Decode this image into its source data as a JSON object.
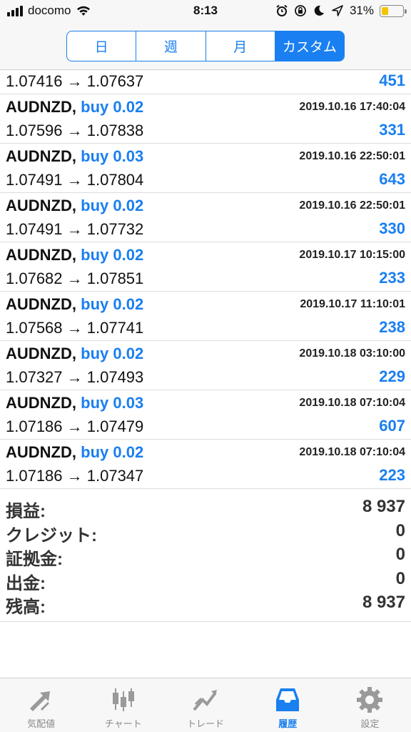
{
  "status_bar": {
    "carrier": "docomo",
    "time": "8:13",
    "battery_percent": "31%",
    "battery_level": 0.31,
    "icons": [
      "signal-icon",
      "wifi-icon",
      "alarm-icon",
      "orientation-lock-icon",
      "moon-icon",
      "location-icon",
      "battery-icon"
    ]
  },
  "period_tabs": [
    {
      "label": "日",
      "active": false
    },
    {
      "label": "週",
      "active": false
    },
    {
      "label": "月",
      "active": false
    },
    {
      "label": "カスタム",
      "active": true
    }
  ],
  "history": {
    "partial_row": {
      "prices": "1.07416 → 1.07637",
      "profit": "451"
    },
    "rows": [
      {
        "symbol": "AUDNZD",
        "separator": ",",
        "trade": "buy 0.02",
        "timestamp": "2019.10.16 17:40:04",
        "prices": "1.07596 → 1.07838",
        "profit": "331"
      },
      {
        "symbol": "AUDNZD",
        "separator": ",",
        "trade": "buy 0.03",
        "timestamp": "2019.10.16 22:50:01",
        "prices": "1.07491 → 1.07804",
        "profit": "643"
      },
      {
        "symbol": "AUDNZD",
        "separator": ",",
        "trade": "buy 0.02",
        "timestamp": "2019.10.16 22:50:01",
        "prices": "1.07491 → 1.07732",
        "profit": "330"
      },
      {
        "symbol": "AUDNZD",
        "separator": ",",
        "trade": "buy 0.02",
        "timestamp": "2019.10.17 10:15:00",
        "prices": "1.07682 → 1.07851",
        "profit": "233"
      },
      {
        "symbol": "AUDNZD",
        "separator": ",",
        "trade": "buy 0.02",
        "timestamp": "2019.10.17 11:10:01",
        "prices": "1.07568 → 1.07741",
        "profit": "238"
      },
      {
        "symbol": "AUDNZD",
        "separator": ",",
        "trade": "buy 0.02",
        "timestamp": "2019.10.18 03:10:00",
        "prices": "1.07327 → 1.07493",
        "profit": "229"
      },
      {
        "symbol": "AUDNZD",
        "separator": ",",
        "trade": "buy 0.03",
        "timestamp": "2019.10.18 07:10:04",
        "prices": "1.07186 → 1.07479",
        "profit": "607"
      },
      {
        "symbol": "AUDNZD",
        "separator": ",",
        "trade": "buy 0.02",
        "timestamp": "2019.10.18 07:10:04",
        "prices": "1.07186 → 1.07347",
        "profit": "223"
      }
    ]
  },
  "summary": [
    {
      "label": "損益:",
      "value": "8 937"
    },
    {
      "label": "クレジット:",
      "value": "0"
    },
    {
      "label": "証拠金:",
      "value": "0"
    },
    {
      "label": "出金:",
      "value": "0"
    },
    {
      "label": "残高:",
      "value": "8 937"
    }
  ],
  "tab_bar": [
    {
      "label": "気配値",
      "icon": "quotes-arrows-icon",
      "active": false
    },
    {
      "label": "チャート",
      "icon": "candlestick-chart-icon",
      "active": false
    },
    {
      "label": "トレード",
      "icon": "trade-trend-icon",
      "active": false
    },
    {
      "label": "履歴",
      "icon": "history-inbox-icon",
      "active": true
    },
    {
      "label": "設定",
      "icon": "settings-gear-icon",
      "active": false
    }
  ],
  "colors": {
    "accent": "#1a7ff0",
    "inactive": "#8a8a8a",
    "battery": "#f5c400"
  }
}
